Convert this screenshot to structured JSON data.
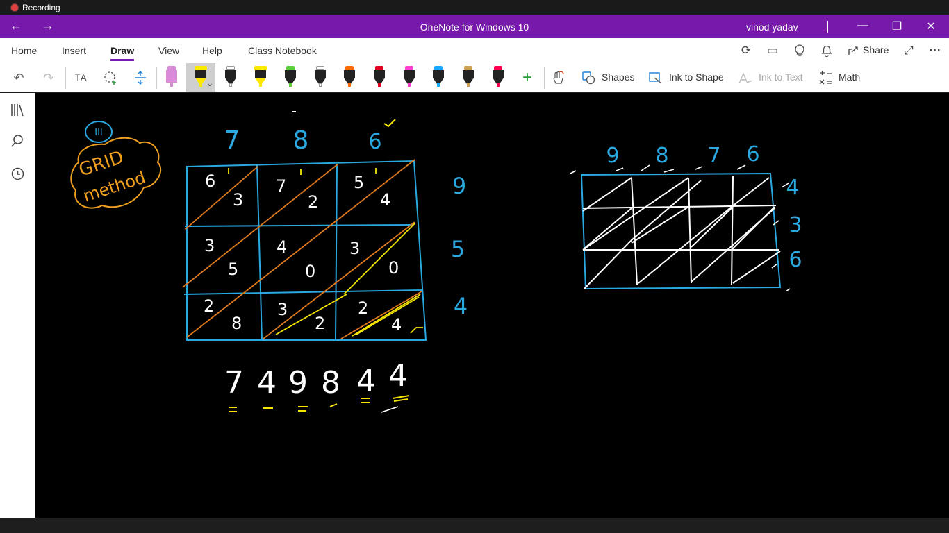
{
  "recording": {
    "label": "Recording"
  },
  "titlebar": {
    "title": "OneNote for Windows 10",
    "user": "vinod yadav",
    "back_glyph": "←",
    "forward_glyph": "→",
    "minimize_glyph": "—",
    "restore_glyph": "❐",
    "close_glyph": "✕"
  },
  "tabs": [
    {
      "label": "Home"
    },
    {
      "label": "Insert"
    },
    {
      "label": "Draw"
    },
    {
      "label": "View"
    },
    {
      "label": "Help"
    },
    {
      "label": "Class Notebook"
    }
  ],
  "tab_icons": {
    "share_label": "Share",
    "more_glyph": "···"
  },
  "toolbar": {
    "shapes_label": "Shapes",
    "ink_to_shape_label": "Ink to Shape",
    "ink_to_text_label": "Ink to Text",
    "math_label": "Math",
    "add_glyph": "+",
    "pens": [
      {
        "name": "pink-eraser",
        "color": "#d98ad9"
      },
      {
        "name": "yellow-highlighter-selected",
        "color": "#ffe800"
      },
      {
        "name": "white-pen",
        "color": "#ffffff"
      },
      {
        "name": "yellow-highlighter",
        "color": "#ffe800"
      },
      {
        "name": "green-pen",
        "color": "#5ad13a"
      },
      {
        "name": "white-pen-2",
        "color": "#ffffff"
      },
      {
        "name": "orange-pen",
        "color": "#ff6a00"
      },
      {
        "name": "red-pen",
        "color": "#e0001b"
      },
      {
        "name": "magenta-pen",
        "color": "#ff3ed0"
      },
      {
        "name": "cyan-pen",
        "color": "#18a8ff"
      },
      {
        "name": "galaxy-pen",
        "color": "#d0a050"
      },
      {
        "name": "crimson-pen",
        "color": "#ff0050"
      }
    ]
  },
  "colors": {
    "accent": "#7719aa",
    "ink_blue": "#2aa8e0",
    "ink_orange": "#e07a1e",
    "ink_yellow": "#f5e600",
    "ink_white": "#ffffff",
    "label_orange": "#f0a020"
  },
  "notes": {
    "roman_numeral": "III",
    "label_line1": "GRID",
    "label_line2": "method",
    "top_digits": [
      "7",
      "8",
      "6"
    ],
    "right_digits": [
      "9",
      "5",
      "4"
    ],
    "cells": [
      [
        "6",
        "3"
      ],
      [
        "7",
        "2"
      ],
      [
        "5",
        "4"
      ],
      [
        "3",
        "5"
      ],
      [
        "4",
        "0"
      ],
      [
        "3",
        "0"
      ],
      [
        "2",
        "8"
      ],
      [
        "3",
        "2"
      ],
      [
        "2",
        "4"
      ]
    ],
    "answer": [
      "7",
      "4",
      "9",
      "8",
      "4",
      "4"
    ],
    "grid2_top_digits": [
      "9",
      "8",
      "7",
      "6"
    ],
    "grid2_right_digits": [
      "4",
      "3",
      "6"
    ]
  }
}
